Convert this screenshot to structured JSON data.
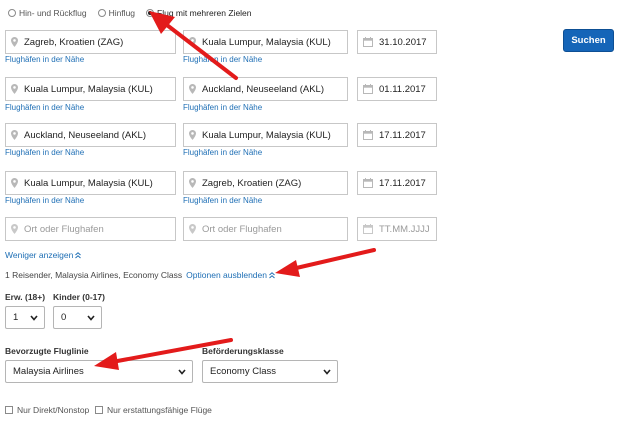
{
  "trip_type": {
    "options": [
      "Hin- und Rückflug",
      "Hinflug",
      "Flug mit mehreren Zielen"
    ],
    "selected_index": 2
  },
  "segments": [
    {
      "origin": "Zagreb, Kroatien (ZAG)",
      "destination": "Kuala Lumpur, Malaysia (KUL)",
      "date": "31.10.2017",
      "origin_nearby": "Flughäfen in der Nähe",
      "destination_nearby": "Flughäfen in der Nähe"
    },
    {
      "origin": "Kuala Lumpur, Malaysia (KUL)",
      "destination": "Auckland, Neuseeland (AKL)",
      "date": "01.11.2017",
      "origin_nearby": "Flughäfen in der Nähe",
      "destination_nearby": "Flughäfen in der Nähe"
    },
    {
      "origin": "Auckland, Neuseeland (AKL)",
      "destination": "Kuala Lumpur, Malaysia (KUL)",
      "date": "17.11.2017",
      "origin_nearby": "Flughäfen in der Nähe",
      "destination_nearby": "Flughäfen in der Nähe"
    },
    {
      "origin": "Kuala Lumpur, Malaysia (KUL)",
      "destination": "Zagreb, Kroatien (ZAG)",
      "date": "17.11.2017",
      "origin_nearby": "Flughäfen in der Nähe",
      "destination_nearby": "Flughäfen in der Nähe"
    }
  ],
  "empty_segment": {
    "origin_placeholder": "Ort oder Flughafen",
    "destination_placeholder": "Ort oder Flughafen",
    "date_placeholder": "TT.MM.JJJJ"
  },
  "search_button": "Suchen",
  "show_less": "Weniger anzeigen",
  "summary": {
    "text": "1 Reisender, Malaysia Airlines, Economy Class",
    "hide_options": "Optionen ausblenden"
  },
  "passengers": {
    "adults_label": "Erw. (18+)",
    "adults_value": "1",
    "children_label": "Kinder (0-17)",
    "children_value": "0"
  },
  "airline": {
    "label": "Bevorzugte Fluglinie",
    "value": "Malaysia Airlines"
  },
  "cabin": {
    "label": "Beförderungsklasse",
    "value": "Economy Class"
  },
  "checkboxes": [
    "Nur Direkt/Nonstop",
    "Nur erstattungsfähige Flüge"
  ],
  "colors": {
    "link": "#1f6fb5",
    "button": "#1565b8",
    "annotation_arrow": "#e31b1b"
  }
}
